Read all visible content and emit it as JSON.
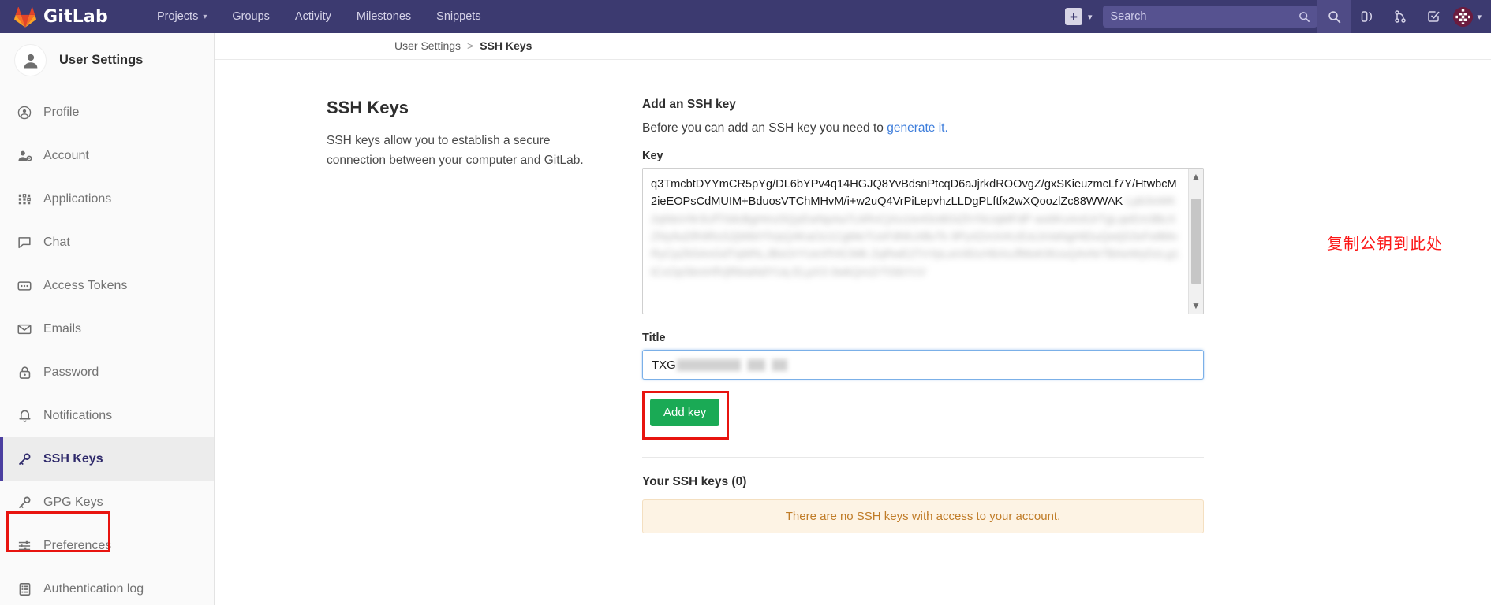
{
  "topnav": {
    "brand": "GitLab",
    "brand_icon": "gitlab-logo-icon",
    "links": [
      {
        "label": "Projects",
        "has_caret": true
      },
      {
        "label": "Groups",
        "has_caret": false
      },
      {
        "label": "Activity",
        "has_caret": false
      },
      {
        "label": "Milestones",
        "has_caret": false
      },
      {
        "label": "Snippets",
        "has_caret": false
      }
    ],
    "plus_label": "+",
    "caret_glyph": "⌄",
    "search_placeholder": "Search",
    "icons": [
      {
        "name": "search-icon"
      },
      {
        "name": "issues-board-icon"
      },
      {
        "name": "merge-requests-icon"
      },
      {
        "name": "todos-icon"
      }
    ],
    "accent_bg": "#3c3a70",
    "search_bg": "#565290"
  },
  "sidebar": {
    "title": "User Settings",
    "avatar_icon": "user-avatar-icon",
    "items": [
      {
        "label": "Profile",
        "icon": "profile-icon",
        "active": false
      },
      {
        "label": "Account",
        "icon": "account-icon",
        "active": false
      },
      {
        "label": "Applications",
        "icon": "applications-grid-icon",
        "active": false
      },
      {
        "label": "Chat",
        "icon": "chat-bubble-icon",
        "active": false
      },
      {
        "label": "Access Tokens",
        "icon": "access-tokens-icon",
        "active": false
      },
      {
        "label": "Emails",
        "icon": "envelope-icon",
        "active": false
      },
      {
        "label": "Password",
        "icon": "lock-icon",
        "active": false
      },
      {
        "label": "Notifications",
        "icon": "bell-icon",
        "active": false
      },
      {
        "label": "SSH Keys",
        "icon": "key-icon",
        "active": true
      },
      {
        "label": "GPG Keys",
        "icon": "key-icon",
        "active": false
      },
      {
        "label": "Preferences",
        "icon": "sliders-icon",
        "active": false
      },
      {
        "label": "Authentication log",
        "icon": "log-list-icon",
        "active": false
      }
    ],
    "active_color": "#2f2a6b"
  },
  "breadcrumb": {
    "parent": "User Settings",
    "separator": ">",
    "current": "SSH Keys"
  },
  "main": {
    "left": {
      "heading": "SSH Keys",
      "description": "SSH keys allow you to establish a secure connection between your computer and GitLab."
    },
    "right": {
      "section_title": "Add an SSH key",
      "subtitle_before": "Before you can add an SSH key you need to ",
      "subtitle_link": "generate it.",
      "key_label": "Key",
      "key_value": "q3TmcbtDYYmCR5pYg/DL6bYPv4q14HGJQ8YvBdsnPtcqD6aJjrkdROOvgZ/gxSKieuzmcLf7Y/HtwbcM2ieEOPsCdMUIM+BduosVTChMHvM/i+w2uQ4VrPiLepvhzLLDgPLftfx2wXQoozlZc88WWAK",
      "key_value_redacted": "Lpb3xWK2qNtsV9r3UfT0dcBgHmz5QyEwNpAa7LkRvCjXo1Ie4Sn8GtZhYbUqMFdP ws6KvAn0JrTgLqeEm3BcXZNy9uDfHiRoS2jWbtYlVpQ4KaOz1CgMe7UxFdNhJrBvTs 9Py4ZmXrKcEoLbVaNgHtDuQwIjS3xFe8MvRyCpZk5AnGdTqWhLJBsOrYUeXfVtCiMk ZqRwE2TnYpLaVdGcHbXsJfMoKi9UuQ4vNr7BAeWyDzLg1tCxOpSkmHfVjRbIaNdYUq ELpX3 0wkQmZrTtSbYcV",
      "title_label": "Title",
      "title_value": "TXG",
      "add_key_button": "Add key",
      "your_keys_heading": "Your SSH keys (0)",
      "empty_message": "There are no SSH keys with access to your account.",
      "add_button_color": "#1aaa55",
      "link_color": "#3d7ddb",
      "alert_bg": "#fdf3e4",
      "alert_text_color": "#c07c28"
    }
  },
  "annotations": {
    "chinese_note": "复制公钥到此处",
    "box_color": "#e8140f",
    "note_color": "#fc1717"
  }
}
